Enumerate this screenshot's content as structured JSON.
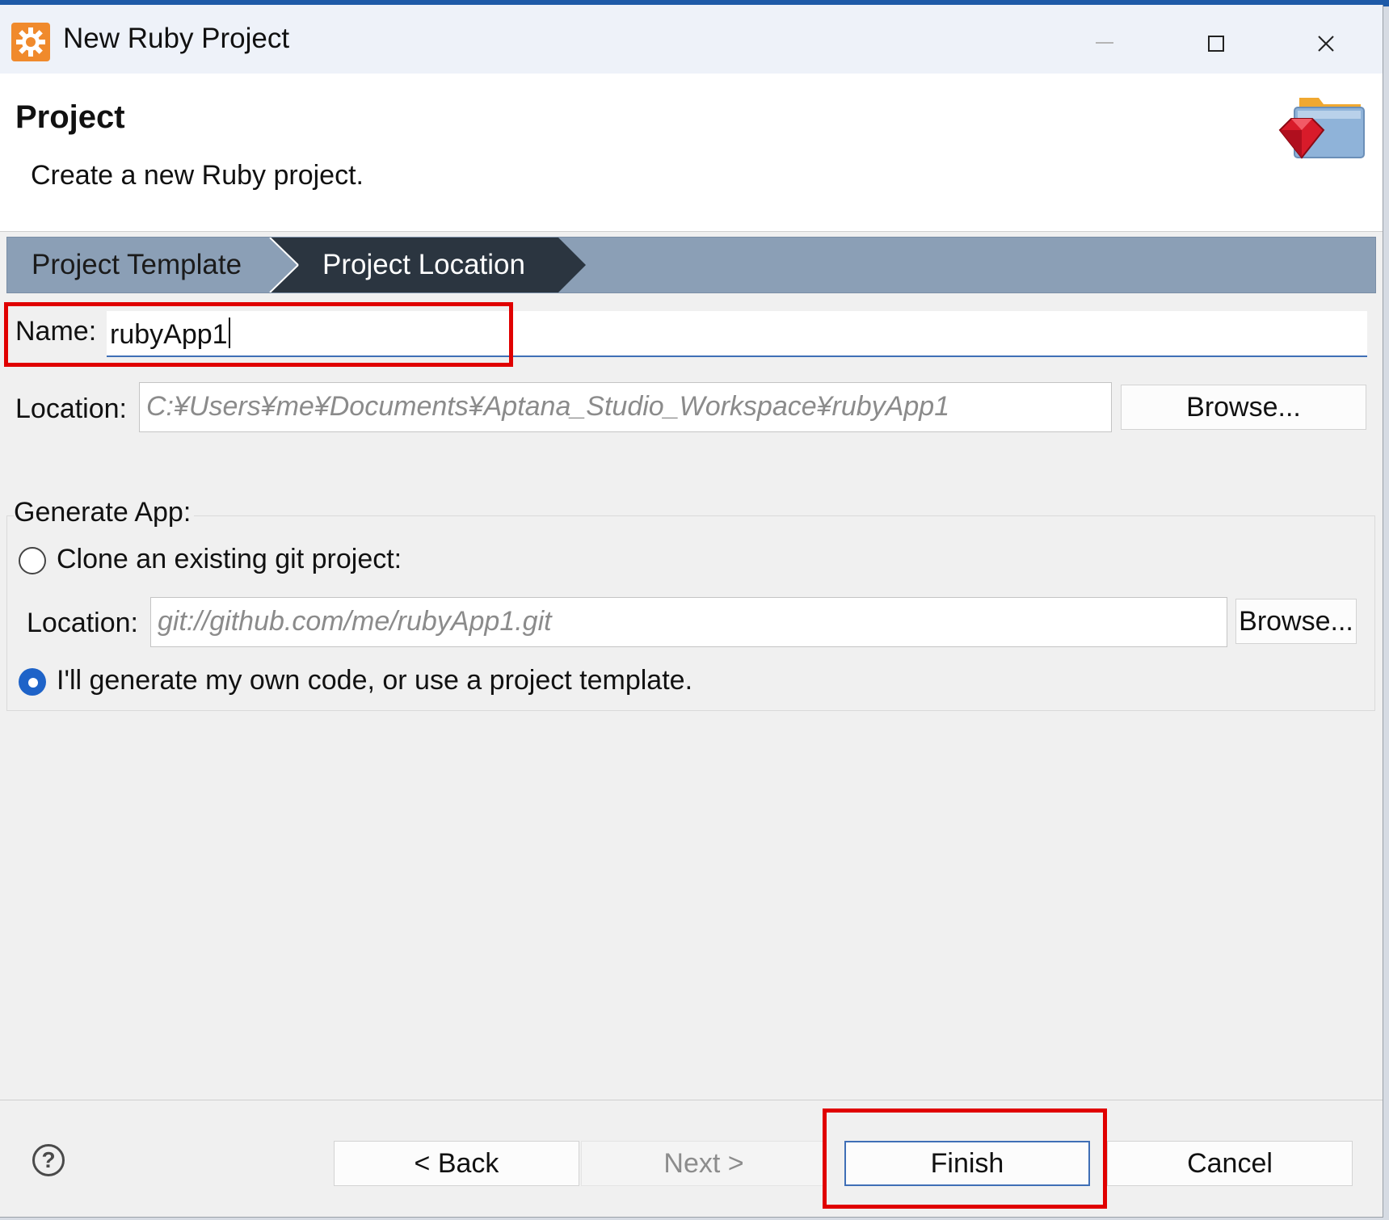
{
  "window": {
    "title": "New Ruby Project",
    "controls": {
      "minimize": "minimize",
      "maximize": "maximize",
      "close": "close"
    }
  },
  "banner": {
    "title": "Project",
    "description": "Create a new Ruby project.",
    "icon": "ruby-folder-icon"
  },
  "breadcrumb": {
    "items": [
      {
        "label": "Project Template",
        "active": false
      },
      {
        "label": "Project Location",
        "active": true
      }
    ]
  },
  "form": {
    "name_label": "Name:",
    "name_value": "rubyApp1",
    "location_label": "Location:",
    "location_placeholder": "C:¥Users¥me¥Documents¥Aptana_Studio_Workspace¥rubyApp1",
    "browse_label": "Browse..."
  },
  "generate_app": {
    "label": "Generate App:",
    "clone_option": "Clone an existing git project:",
    "clone_selected": false,
    "git_location_label": "Location:",
    "git_location_placeholder": "git://github.com/me/rubyApp1.git",
    "git_browse_label": "Browse...",
    "own_code_option": "I'll generate my own code, or use a project template.",
    "own_code_selected": true
  },
  "footer": {
    "help_icon": "help-icon",
    "back_label": "< Back",
    "next_label": "Next >",
    "finish_label": "Finish",
    "cancel_label": "Cancel"
  },
  "colors": {
    "accent": "#1e63c8",
    "breadcrumb_bg": "#8b9fb6",
    "breadcrumb_active": "#2b3540",
    "highlight": "#e00000"
  }
}
